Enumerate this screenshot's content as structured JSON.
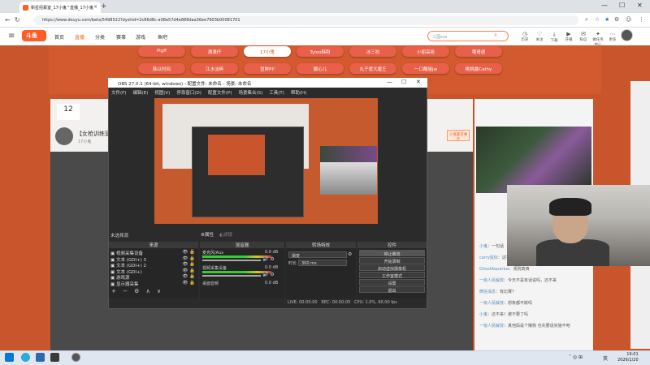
{
  "browser": {
    "tab_title": "新星招募室_17小鬼^直播_17小鬼",
    "url": "https://www.douyu.com/beta/5498522?dyshid=2c86d8c-a08e57d4e888daa36ee7903b00081701"
  },
  "site": {
    "logo": "斗鱼",
    "nav": [
      "首页",
      "直播",
      "分类",
      "赛事",
      "游戏",
      "鱼吧"
    ],
    "search_placeholder": "三国sus",
    "header_icons": [
      {
        "icon": "history-icon",
        "label": "历史"
      },
      {
        "icon": "follow-icon",
        "label": "关注"
      },
      {
        "icon": "download-icon",
        "label": "下载"
      },
      {
        "icon": "live-icon",
        "label": "开播"
      },
      {
        "icon": "message-icon",
        "label": "私信"
      },
      {
        "icon": "task-icon",
        "label": "做任务中心"
      },
      {
        "icon": "more-icon",
        "label": "更多"
      }
    ]
  },
  "banner_pills": [
    "Pigff",
    "滴滴仔",
    "17小鬼",
    "Tyloo韩阳",
    "冰三叻",
    "小朋高吸",
    "噶哥遇",
    "韩以时间",
    "江水淡碎",
    "冒鲜PP",
    "顺心儿",
    "丸子君大魔王",
    "一口醒姐jw",
    "桃桃露Cathy"
  ],
  "room": {
    "follow_count": "12",
    "title": "【女枪训练营",
    "sub": "17小鬼",
    "badge": "小鬼最近要走"
  },
  "chat": [
    {
      "user": "小鬼",
      "text": "一句话"
    },
    {
      "user": "carry鼠标",
      "text": "这补看不起，你猜猜吧"
    },
    {
      "user": "GhostAquarius",
      "text": "观则真爽"
    },
    {
      "user": "一级人民解放",
      "text": "今天不是有话说吗，还不来"
    },
    {
      "user": "微信消息",
      "text": "有比赛？"
    },
    {
      "user": "一级人民解放",
      "text": "想象都不斯吗"
    },
    {
      "user": "小鬼",
      "text": "还不来！被不要了吗"
    },
    {
      "user": "一级人民解放",
      "text": "真他妈是个懒狗 也先要说实施不吧"
    }
  ],
  "obs": {
    "title": "OBS 27.0.1 (64-bit, windows) - 配置文件: 未命名 - 场景: 未命名",
    "menu": [
      "文件(F)",
      "编辑(E)",
      "视图(V)",
      "停靠窗口(D)",
      "配置文件(P)",
      "场景集合(S)",
      "工具(T)",
      "帮助(H)"
    ],
    "no_source": "未选择源",
    "props_btn": "属性",
    "filter_btn": "滤镜",
    "docks": {
      "sources": "来源",
      "mixer": "混音器",
      "transition": "转场特效",
      "controls": "控件"
    },
    "sources": [
      "视频采集设备",
      "文本 (GDI+) 3",
      "文本 (GDI+) 2",
      "文本 (GDI+)",
      "游戏源",
      "显示器采集"
    ],
    "mixer": [
      {
        "name": "麦克风/Aux",
        "db": "0.0 dB"
      },
      {
        "name": "视频采集设备",
        "db": "0.0 dB"
      },
      {
        "name": "桌面音频",
        "db": "0.0 dB"
      }
    ],
    "transition": {
      "type": "渐变",
      "duration_label": "时长",
      "duration": "300 ms"
    },
    "controls": [
      "停止推流",
      "开始录制",
      "启动虚拟摄像机",
      "工作室模式",
      "设置",
      "退出"
    ],
    "status": {
      "live": "LIVE: 00:00:00",
      "rec": "REC: 00:00:00",
      "cpu": "CPU: 1.0%, 60.00 fps"
    }
  },
  "taskbar": {
    "time": "19:01",
    "date": "2026/1/20",
    "lang": "英"
  }
}
